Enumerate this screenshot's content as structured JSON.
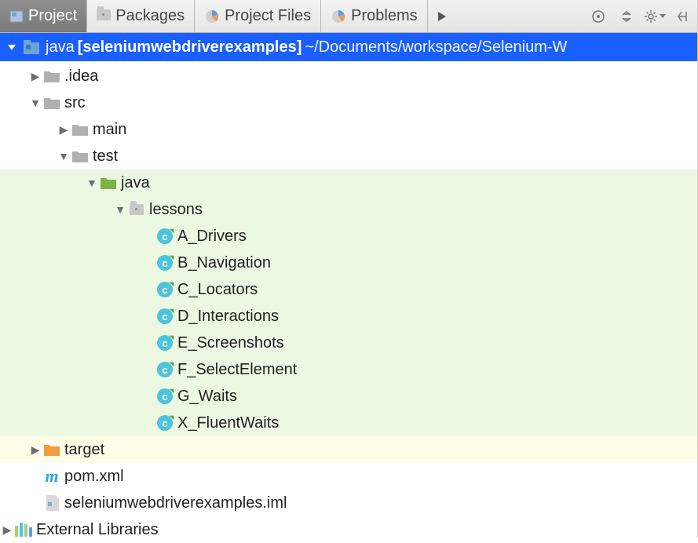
{
  "tabs": [
    {
      "label": "Project",
      "active": true,
      "icon": "project"
    },
    {
      "label": "Packages",
      "active": false,
      "icon": "package"
    },
    {
      "label": "Project Files",
      "active": false,
      "icon": "pie"
    },
    {
      "label": "Problems",
      "active": false,
      "icon": "pie"
    }
  ],
  "selection": {
    "name": "java",
    "module": "[seleniumwebdriverexamples]",
    "path_display": "~/Documents/workspace/Selenium-W"
  },
  "tree": {
    "idea": ".idea",
    "src": "src",
    "main": "main",
    "test": "test",
    "java": "java",
    "lessons": "lessons",
    "classes": [
      "A_Drivers",
      "B_Navigation",
      "C_Locators",
      "D_Interactions",
      "E_Screenshots",
      "F_SelectElement",
      "G_Waits",
      "X_FluentWaits"
    ],
    "target": "target",
    "pom": "pom.xml",
    "iml": "seleniumwebdriverexamples.iml",
    "ext_libs": "External Libraries"
  }
}
